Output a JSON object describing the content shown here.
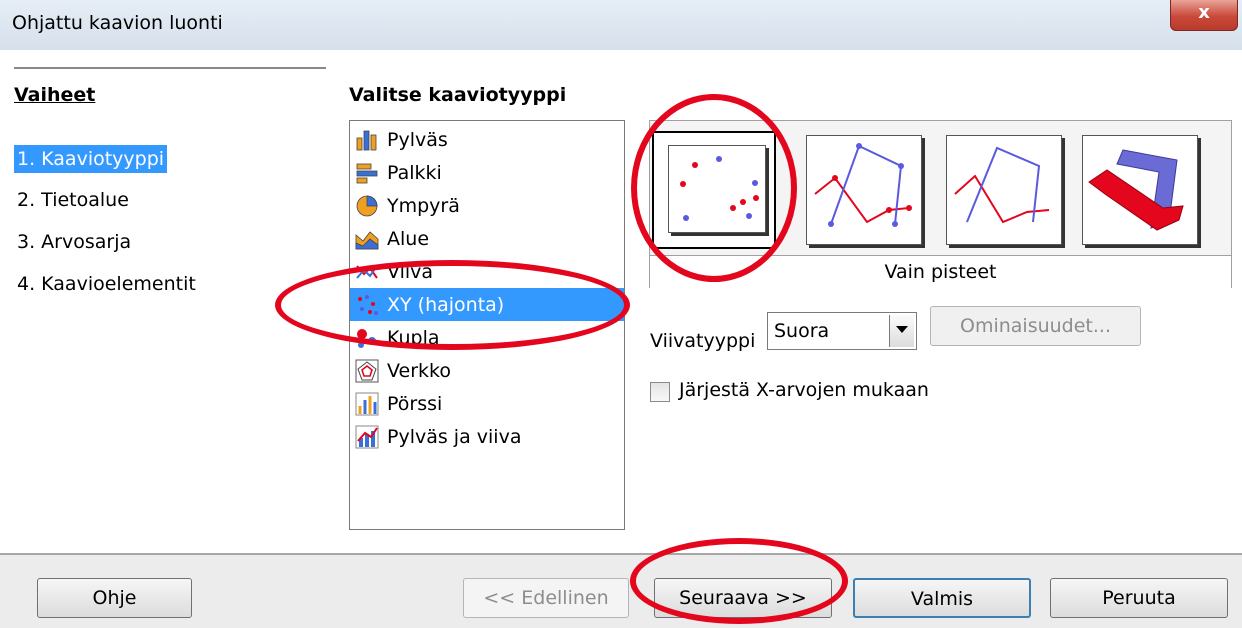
{
  "window": {
    "title": "Ohjattu kaavion luonti",
    "close_glyph": "x"
  },
  "steps": {
    "heading": "Vaiheet",
    "items": [
      {
        "label": "1. Kaaviotyyppi",
        "active": true
      },
      {
        "label": "2. Tietoalue"
      },
      {
        "label": "3. Arvosarja"
      },
      {
        "label": "4. Kaavioelementit"
      }
    ]
  },
  "chart_types": {
    "heading": "Valitse kaaviotyyppi",
    "items": [
      {
        "label": "Pylväs",
        "icon": "column-chart-icon"
      },
      {
        "label": "Palkki",
        "icon": "bar-chart-icon"
      },
      {
        "label": "Ympyrä",
        "icon": "pie-chart-icon"
      },
      {
        "label": "Alue",
        "icon": "area-chart-icon"
      },
      {
        "label": "Viiva",
        "icon": "line-chart-icon"
      },
      {
        "label": "XY (hajonta)",
        "icon": "xy-scatter-icon",
        "selected": true
      },
      {
        "label": "Kupla",
        "icon": "bubble-chart-icon"
      },
      {
        "label": "Verkko",
        "icon": "net-chart-icon"
      },
      {
        "label": "Pörssi",
        "icon": "stock-chart-icon"
      },
      {
        "label": "Pylväs ja viiva",
        "icon": "column-and-line-icon"
      }
    ]
  },
  "variants": {
    "caption": "Vain pisteet",
    "items": [
      {
        "icon": "points-only-icon",
        "selected": true
      },
      {
        "icon": "points-and-lines-icon"
      },
      {
        "icon": "lines-only-icon"
      },
      {
        "icon": "3d-lines-icon"
      }
    ]
  },
  "options": {
    "line_type_label": "Viivatyyppi",
    "line_type_value": "Suora",
    "properties_button": "Ominaisuudet...",
    "sort_checkbox_label": "Järjestä X-arvojen mukaan",
    "sort_checked": false
  },
  "buttons": {
    "help": "Ohje",
    "back": "<< Edellinen",
    "next": "Seuraava >>",
    "finish": "Valmis",
    "cancel": "Peruuta"
  },
  "colors": {
    "selection": "#3399ff",
    "annotation": "#e3061d",
    "series_red": "#e3061d",
    "series_blue": "#5a5ae0"
  }
}
